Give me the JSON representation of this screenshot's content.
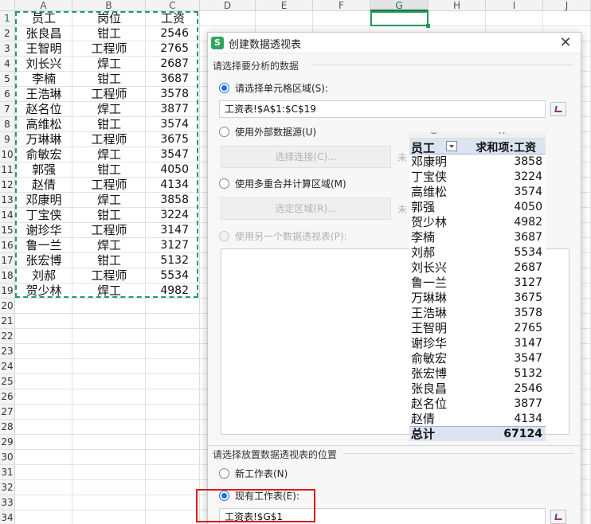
{
  "sheet": {
    "columns": [
      "A",
      "B",
      "C",
      "D",
      "E",
      "F",
      "G",
      "H",
      "I",
      "J"
    ],
    "selected_column": "G",
    "rows": [
      "1",
      "2",
      "3",
      "4",
      "5",
      "6",
      "7",
      "8",
      "9",
      "10",
      "11",
      "12",
      "13",
      "14",
      "15",
      "16",
      "17",
      "18",
      "19",
      "20",
      "21",
      "22",
      "23",
      "24",
      "25",
      "26",
      "27",
      "28",
      "29",
      "30",
      "31",
      "32",
      "33",
      "34"
    ],
    "header": [
      "员工",
      "岗位",
      "工资"
    ],
    "data": [
      [
        "张良昌",
        "钳工",
        "2546"
      ],
      [
        "王智明",
        "工程师",
        "2765"
      ],
      [
        "刘长兴",
        "焊工",
        "2687"
      ],
      [
        "李楠",
        "钳工",
        "3687"
      ],
      [
        "王浩琳",
        "工程师",
        "3578"
      ],
      [
        "赵名位",
        "焊工",
        "3877"
      ],
      [
        "高维松",
        "钳工",
        "3574"
      ],
      [
        "万琳琳",
        "工程师",
        "3675"
      ],
      [
        "俞敏宏",
        "焊工",
        "3547"
      ],
      [
        "郭强",
        "钳工",
        "4050"
      ],
      [
        "赵倩",
        "工程师",
        "4134"
      ],
      [
        "邓康明",
        "焊工",
        "3858"
      ],
      [
        "丁宝侠",
        "钳工",
        "3224"
      ],
      [
        "谢珍华",
        "工程师",
        "3147"
      ],
      [
        "鲁一兰",
        "焊工",
        "3127"
      ],
      [
        "张宏博",
        "钳工",
        "5132"
      ],
      [
        "刘郝",
        "工程师",
        "5534"
      ],
      [
        "贺少林",
        "焊工",
        "4982"
      ]
    ]
  },
  "dialog": {
    "title": "创建数据透视表",
    "app_icon": "S",
    "close_icon": "✕",
    "section_source": "请选择要分析的数据",
    "opt_range_label": "请选择单元格区域(S):",
    "range_value": "工资表!$A$1:$C$19",
    "opt_external_label": "使用外部数据源(U)",
    "btn_select_connection": "选择连接(C)...",
    "trailing_external": "未",
    "opt_multi_label": "使用多重合并计算区域(M)",
    "btn_select_region": "选定区域(R)...",
    "trailing_multi": "未",
    "opt_other_pivot_label": "使用另一个数据透视表(P):",
    "section_dest": "请选择放置数据透视表的位置",
    "opt_new_sheet_label": "新工作表(N)",
    "opt_existing_label": "现有工作表(E):",
    "dest_value": "工资表!$G$1"
  },
  "pivot": {
    "header_name": "员工",
    "header_value": "求和项:工资",
    "col_strip": [
      "G",
      "H"
    ],
    "rows": [
      [
        "邓康明",
        "3858"
      ],
      [
        "丁宝侠",
        "3224"
      ],
      [
        "高维松",
        "3574"
      ],
      [
        "郭强",
        "4050"
      ],
      [
        "贺少林",
        "4982"
      ],
      [
        "李楠",
        "3687"
      ],
      [
        "刘郝",
        "5534"
      ],
      [
        "刘长兴",
        "2687"
      ],
      [
        "鲁一兰",
        "3127"
      ],
      [
        "万琳琳",
        "3675"
      ],
      [
        "王浩琳",
        "3578"
      ],
      [
        "王智明",
        "2765"
      ],
      [
        "谢珍华",
        "3147"
      ],
      [
        "俞敏宏",
        "3547"
      ],
      [
        "张宏博",
        "5132"
      ],
      [
        "张良昌",
        "2546"
      ],
      [
        "赵名位",
        "3877"
      ],
      [
        "赵倩",
        "4134"
      ]
    ],
    "total_label": "总计",
    "total_value": "67124"
  },
  "colors": {
    "accent_green": "#1f9d5a",
    "radio_blue": "#1a73e8",
    "highlight_red": "#e01818",
    "pivot_header": "#dce4f1"
  }
}
